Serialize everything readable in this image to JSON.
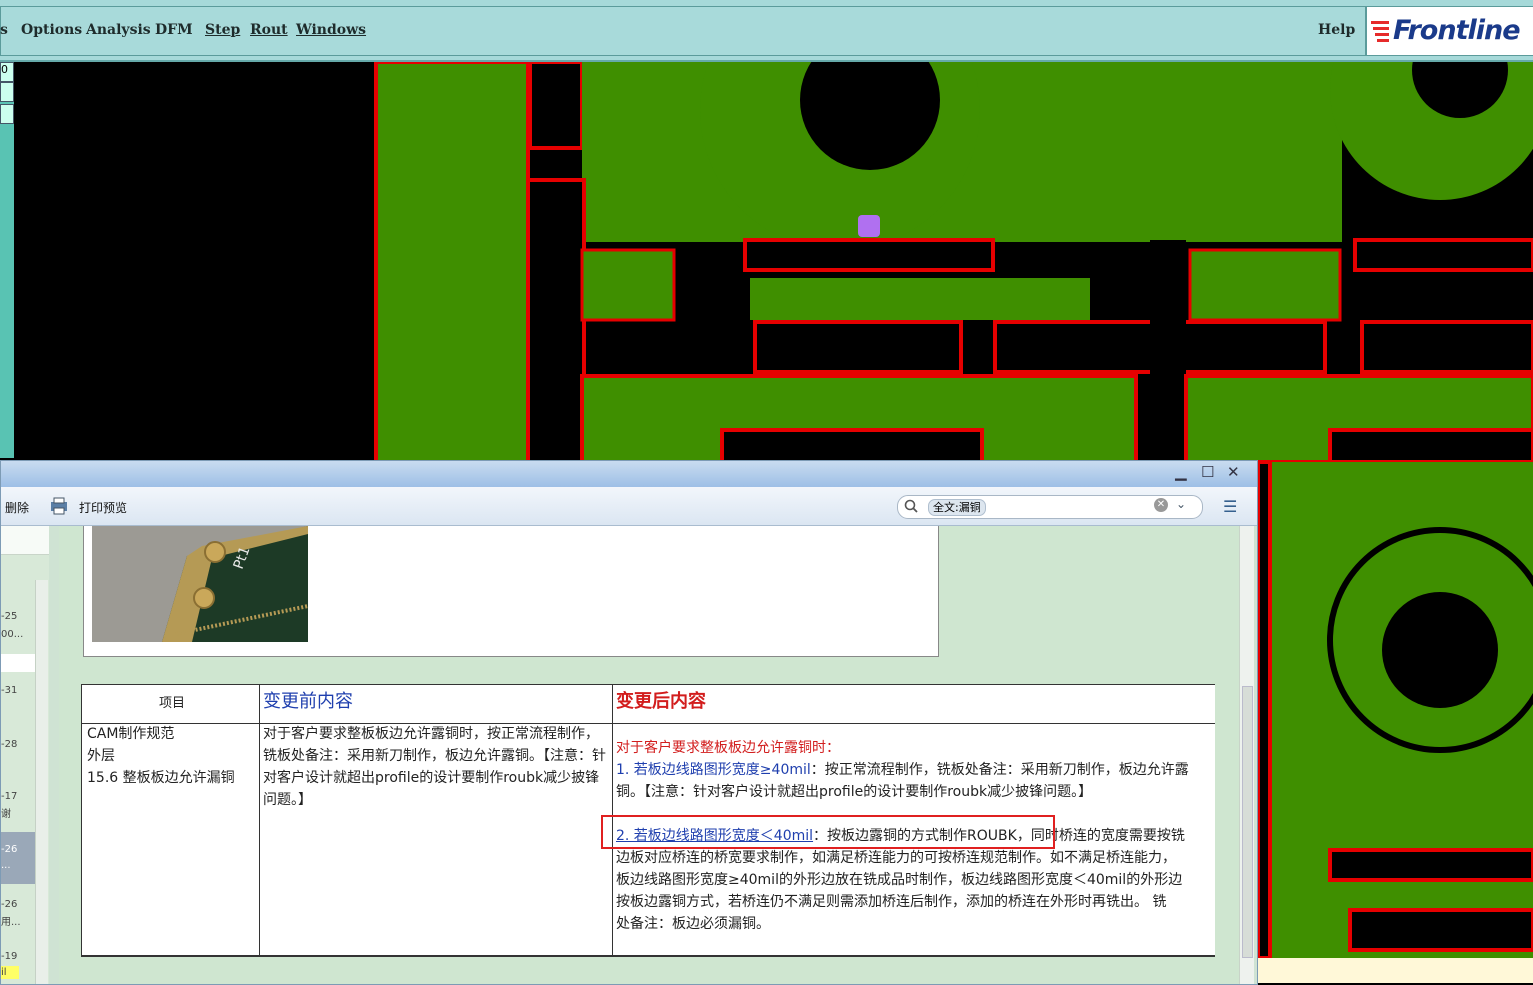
{
  "menubar": {
    "items": [
      "s",
      "Options",
      "Analysis",
      "DFM",
      "Step",
      "Rout",
      "Windows"
    ],
    "help": "Help",
    "logo": "Frontline"
  },
  "left_strip": {
    "label": "0"
  },
  "colors": {
    "copper": "#3f8f00",
    "outline": "#e60000",
    "background": "#000000",
    "marker": "#b070f0"
  },
  "document_window": {
    "toolbar": {
      "delete_label": "删除",
      "print_preview_label": "打印预览"
    },
    "search": {
      "tag": "全文:漏铜"
    },
    "sidebar_entries": [
      "-25",
      "00...",
      "-31",
      "-28",
      "-17",
      "谢",
      "-26",
      "...",
      "-26",
      "用...",
      "-19",
      "il"
    ],
    "photo_label": "Pt1",
    "table": {
      "headers": {
        "item": "项目",
        "before": "变更前内容",
        "after": "变更后内容"
      },
      "item_lines": [
        "CAM制作规范",
        "外层",
        "15.6 整板板边允许漏铜"
      ],
      "before_text": "对于客户要求整板板边允许露铜时，按正常流程制作，铣板处备注：采用新刀制作，板边允许露铜。【注意：针对客户设计就超出profile的设计要制作roubk减少披锋问题。】",
      "after": {
        "intro": "对于客户要求整板板边允许露铜时：",
        "p1_blue": "1. 若板边线路图形宽度≥40mil",
        "p1_black": "：按正常流程制作，铣板处备注：采用新刀制作，板边允许露",
        "p1_line2": "铜。【注意：针对客户设计就超出profile的设计要制作roubk减少披锋问题。】",
        "p2_blue": "2. 若板边线路图形宽度＜40mil",
        "p2_black": "：按板边露铜的方式制作ROUBK",
        "p2_rest": "，同时桥连的宽度需要按铣",
        "p2_lines": [
          "边板对应桥连的桥宽要求制作，如满足桥连能力的可按桥连规范制作。如不满足桥连能力，",
          "板边线路图形宽度≥40mil的外形边放在铣成品时制作，板边线路图形宽度＜40mil的外形边",
          "按板边露铜方式，若桥连仍不满足则需添加桥连后制作，添加的桥连在外形时再铣出。 铣",
          "处备注：板边必须漏铜。"
        ]
      }
    }
  }
}
